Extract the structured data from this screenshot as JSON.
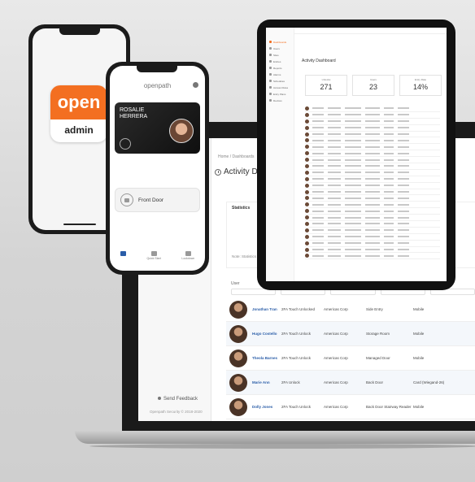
{
  "phone_admin": {
    "logo_top": "open",
    "logo_bottom": "admin"
  },
  "phone_app": {
    "brand": "openpath",
    "card_name": "ROSALIE HERRERA",
    "door_label": "Front Door",
    "nav": [
      "",
      "Quick Start",
      "Lockdown"
    ]
  },
  "laptop": {
    "breadcrumb": "Home / Dashboards",
    "title": "Activity Das",
    "stats_label": "Statistics",
    "stats_note": "Note: Statistics are...",
    "feedback": "Send Feedback",
    "copyright": "Openpath Security © 2018-2020",
    "table_header": "User",
    "rows": [
      {
        "name": "Jonathan Tran",
        "action": "2FA Touch Unlocked",
        "site": "Americas Corp",
        "door": "Side Entry",
        "device": "Mobile"
      },
      {
        "name": "Hugo Costello",
        "action": "2FA Touch Unlock",
        "site": "Americas Corp",
        "door": "Storage Room",
        "device": "Mobile"
      },
      {
        "name": "Theola Barnes",
        "action": "2FA Touch Unlock",
        "site": "Americas Corp",
        "door": "Managed Door",
        "device": "Mobile"
      },
      {
        "name": "Marie Ann",
        "action": "2FA Unlock",
        "site": "Americas Corp",
        "door": "Back Door",
        "device": "Card (Wiegand-26)"
      },
      {
        "name": "Dolly Jones",
        "action": "2FA Touch Unlock",
        "site": "Americas Corp",
        "door": "Back Door Stairway Reader",
        "device": "Mobile"
      }
    ]
  },
  "tablet": {
    "title": "Activity Dashboard",
    "stats": [
      {
        "label": "Unlocks",
        "value": "271"
      },
      {
        "label": "Users",
        "value": "23"
      },
      {
        "label": "Entry Rate",
        "value": "14%"
      }
    ],
    "side_items": [
      "Dashboards",
      "Users",
      "Sites",
      "Entries",
      "Reports",
      "Alarms",
      "Schedules",
      "Access Rules",
      "Entry Plans",
      "Devices"
    ]
  }
}
